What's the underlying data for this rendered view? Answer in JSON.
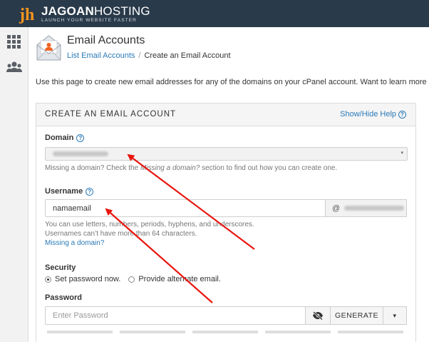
{
  "brand": {
    "name_bold": "JAGOAN",
    "name_light": "HOSTING",
    "tagline": "LAUNCH YOUR WEBSITE FASTER",
    "mark": "jh",
    "accent_color": "#f7941d"
  },
  "sidebar": {
    "items": [
      {
        "icon": "grid-icon"
      },
      {
        "icon": "users-icon"
      }
    ]
  },
  "page": {
    "title": "Email Accounts",
    "breadcrumb": {
      "parent": "List Email Accounts",
      "separator": "/",
      "current": "Create an Email Account"
    },
    "intro": "Use this page to create new email addresses for any of the domains on your cPanel account. Want to learn more"
  },
  "form": {
    "panel_title": "CREATE AN EMAIL ACCOUNT",
    "help_toggle": "Show/Hide Help",
    "domain_label": "Domain",
    "domain_hint_pre": "Missing a domain? Check the ",
    "domain_hint_em": "Missing a domain?",
    "domain_hint_post": " section to find out how you can create one.",
    "username_label": "Username",
    "username_value": "namaemail",
    "username_addon_at": "@",
    "username_hint_1": "You can use letters, numbers, periods, hyphens, and underscores.",
    "username_hint_2": "Usernames can’t have more than 64 characters.",
    "username_link": "Missing a domain?",
    "security_label": "Security",
    "security_option_1": "Set password now.",
    "security_option_2": "Provide alternate email.",
    "password_label": "Password",
    "password_placeholder": "Enter Password",
    "generate_label": "GENERATE",
    "caret": "▾"
  },
  "colors": {
    "header_bg": "#293a4a",
    "link": "#2a7ab8",
    "annotation_arrow": "#e8150e"
  }
}
